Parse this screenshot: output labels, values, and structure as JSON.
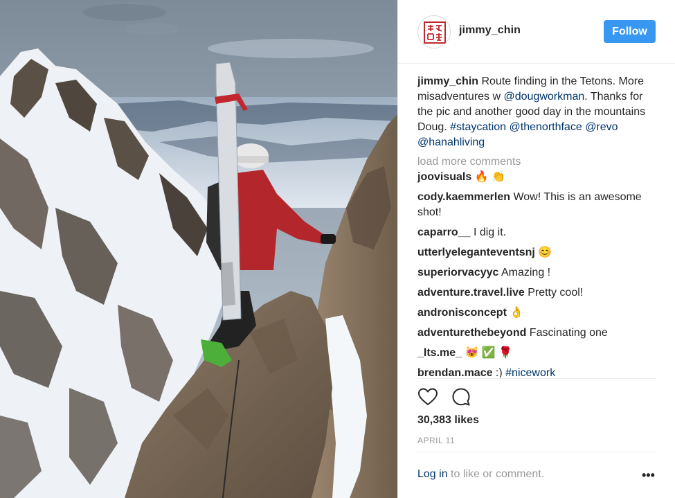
{
  "photo": {
    "description_icon": "mountain-climber-photo"
  },
  "header": {
    "avatar_icon": "seal-logo-avatar",
    "username": "jimmy_chin",
    "follow_label": "Follow"
  },
  "caption": {
    "username": "jimmy_chin",
    "text_1": " Route finding in the Tetons. More misadventures w ",
    "mention_1": "@dougworkman",
    "text_2": ". Thanks for the pic and another good day in the mountains Doug. ",
    "hashtag_1": "#staycation",
    "space_1": " ",
    "mention_2": "@thenorthface",
    "space_2": " ",
    "mention_3": "@revo",
    "space_3": " ",
    "mention_4": "@hanahliving"
  },
  "load_more": "load more comments",
  "comments": [
    {
      "user": "joovisuals",
      "text": " 🔥 👏"
    },
    {
      "user": "cody.kaemmerlen",
      "text": " Wow! This is an awesome shot!"
    },
    {
      "user": "caparro__",
      "text": " I dig it."
    },
    {
      "user": "utterlyeleganteventsnj",
      "text": " 😊"
    },
    {
      "user": "superiorvacyyc",
      "text": " Amazing !"
    },
    {
      "user": "adventure.travel.live",
      "text": " Pretty cool!"
    },
    {
      "user": "andronisconcept",
      "text": " 👌"
    },
    {
      "user": "adventurethebeyond",
      "text": " Fascinating one"
    },
    {
      "user": "_lts.me_",
      "text": " 😻 ✅ 🌹"
    },
    {
      "user": "brendan.mace",
      "text": " :) ",
      "hashtag": "#nicework"
    }
  ],
  "actions": {
    "like_icon": "heart-icon",
    "comment_icon": "comment-bubble-icon"
  },
  "likes": "30,383 likes",
  "date": "APRIL 11",
  "footer": {
    "login": "Log in",
    "rest": " to like or comment.",
    "more": "•••",
    "more_icon": "more-options-icon"
  },
  "colors": {
    "follow": "#3897f0",
    "link": "#003569",
    "muted": "#999999",
    "text": "#262626"
  }
}
